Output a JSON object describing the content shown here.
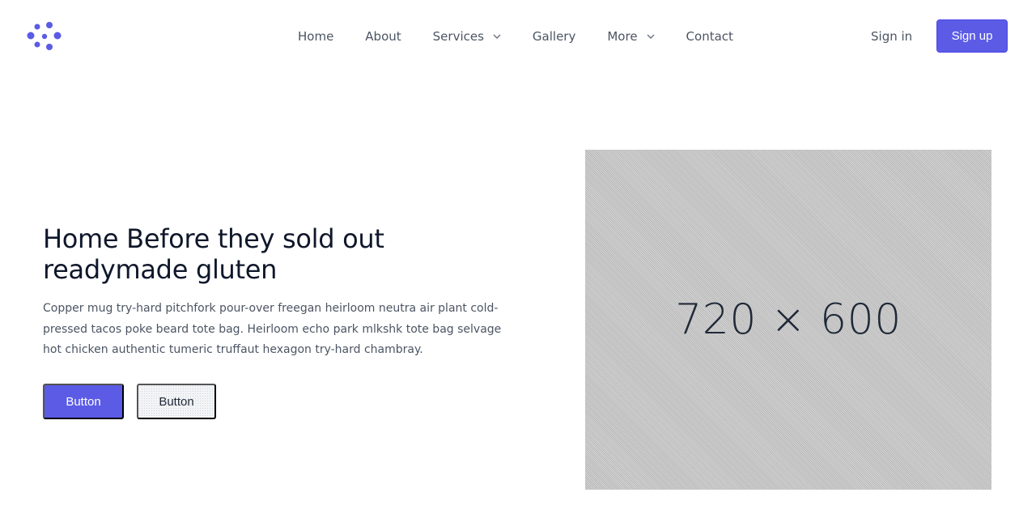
{
  "nav": {
    "logo": "dots-logo-icon",
    "links": [
      {
        "label": "Home",
        "has_dropdown": false
      },
      {
        "label": "About",
        "has_dropdown": false
      },
      {
        "label": "Services",
        "has_dropdown": true
      },
      {
        "label": "Gallery",
        "has_dropdown": false
      },
      {
        "label": "More",
        "has_dropdown": true
      },
      {
        "label": "Contact",
        "has_dropdown": false
      }
    ],
    "sign_in": "Sign in",
    "sign_up": "Sign up"
  },
  "hero": {
    "title_line1": "Home Before they sold out",
    "title_line2": "readymade gluten",
    "description": "Copper mug try-hard pitchfork pour-over freegan heirloom neutra air plant cold-pressed tacos poke beard tote bag. Heirloom echo park mlkshk tote bag selvage hot chicken authentic tumeric truffaut hexagon try-hard chambray.",
    "primary_button": "Button",
    "secondary_button": "Button"
  },
  "image_placeholder": {
    "label": "720 × 600"
  },
  "colors": {
    "accent": "#5b5be6",
    "text_dark": "#0f172a",
    "text_muted": "#4b5563"
  }
}
